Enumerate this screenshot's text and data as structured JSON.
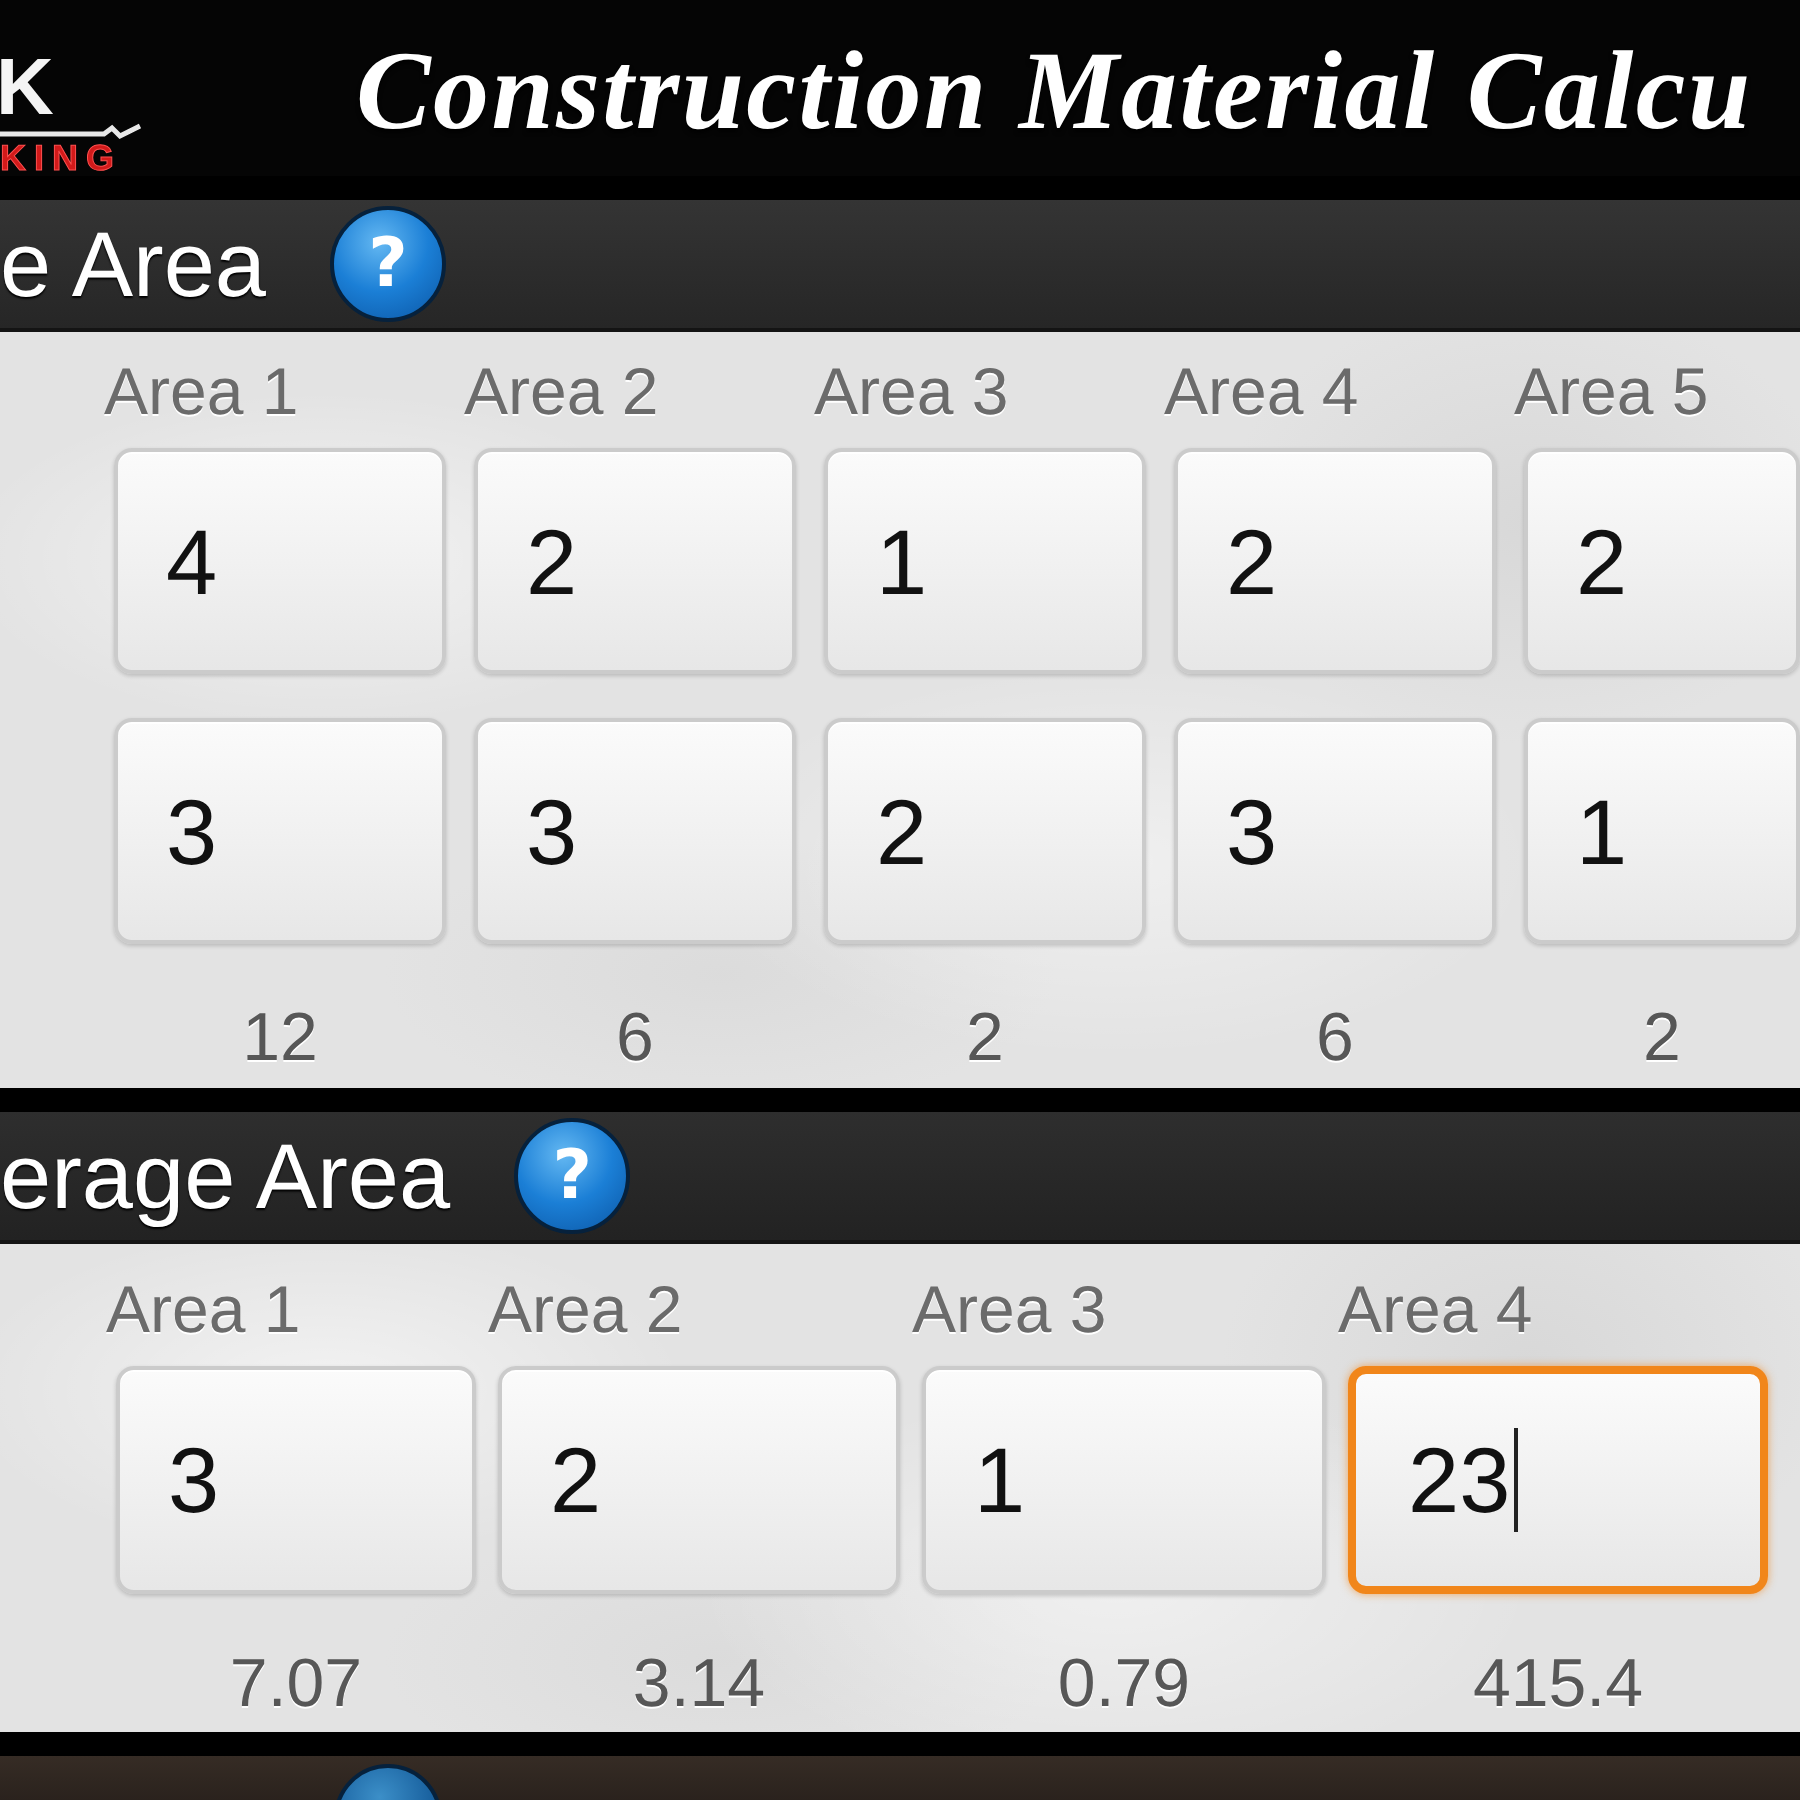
{
  "header": {
    "logo": {
      "mark": "K",
      "tagline": "KING"
    },
    "title": "Construction Material Calcu"
  },
  "sections": [
    {
      "title": "e Area",
      "help": "?",
      "columns": [
        {
          "label": "Area 1",
          "inputs": [
            {
              "value": "4",
              "focused": false
            },
            {
              "value": "3",
              "focused": false
            }
          ],
          "result": "12"
        },
        {
          "label": "Area 2",
          "inputs": [
            {
              "value": "2",
              "focused": false
            },
            {
              "value": "3",
              "focused": false
            }
          ],
          "result": "6"
        },
        {
          "label": "Area 3",
          "inputs": [
            {
              "value": "1",
              "focused": false
            },
            {
              "value": "2",
              "focused": false
            }
          ],
          "result": "2"
        },
        {
          "label": "Area 4",
          "inputs": [
            {
              "value": "2",
              "focused": false
            },
            {
              "value": "3",
              "focused": false
            }
          ],
          "result": "6"
        },
        {
          "label": "Area 5",
          "inputs": [
            {
              "value": "2",
              "focused": false
            },
            {
              "value": "1",
              "focused": false
            }
          ],
          "result": "2"
        }
      ]
    },
    {
      "title": "erage Area",
      "help": "?",
      "columns": [
        {
          "label": "Area 1",
          "inputs": [
            {
              "value": "3",
              "focused": false
            }
          ],
          "result": "7.07"
        },
        {
          "label": "Area 2",
          "inputs": [
            {
              "value": "2",
              "focused": false
            }
          ],
          "result": "3.14"
        },
        {
          "label": "Area 3",
          "inputs": [
            {
              "value": "1",
              "focused": false
            }
          ],
          "result": "0.79"
        },
        {
          "label": "Area 4",
          "inputs": [
            {
              "value": "23",
              "focused": true
            }
          ],
          "result": "415.4"
        }
      ]
    }
  ]
}
